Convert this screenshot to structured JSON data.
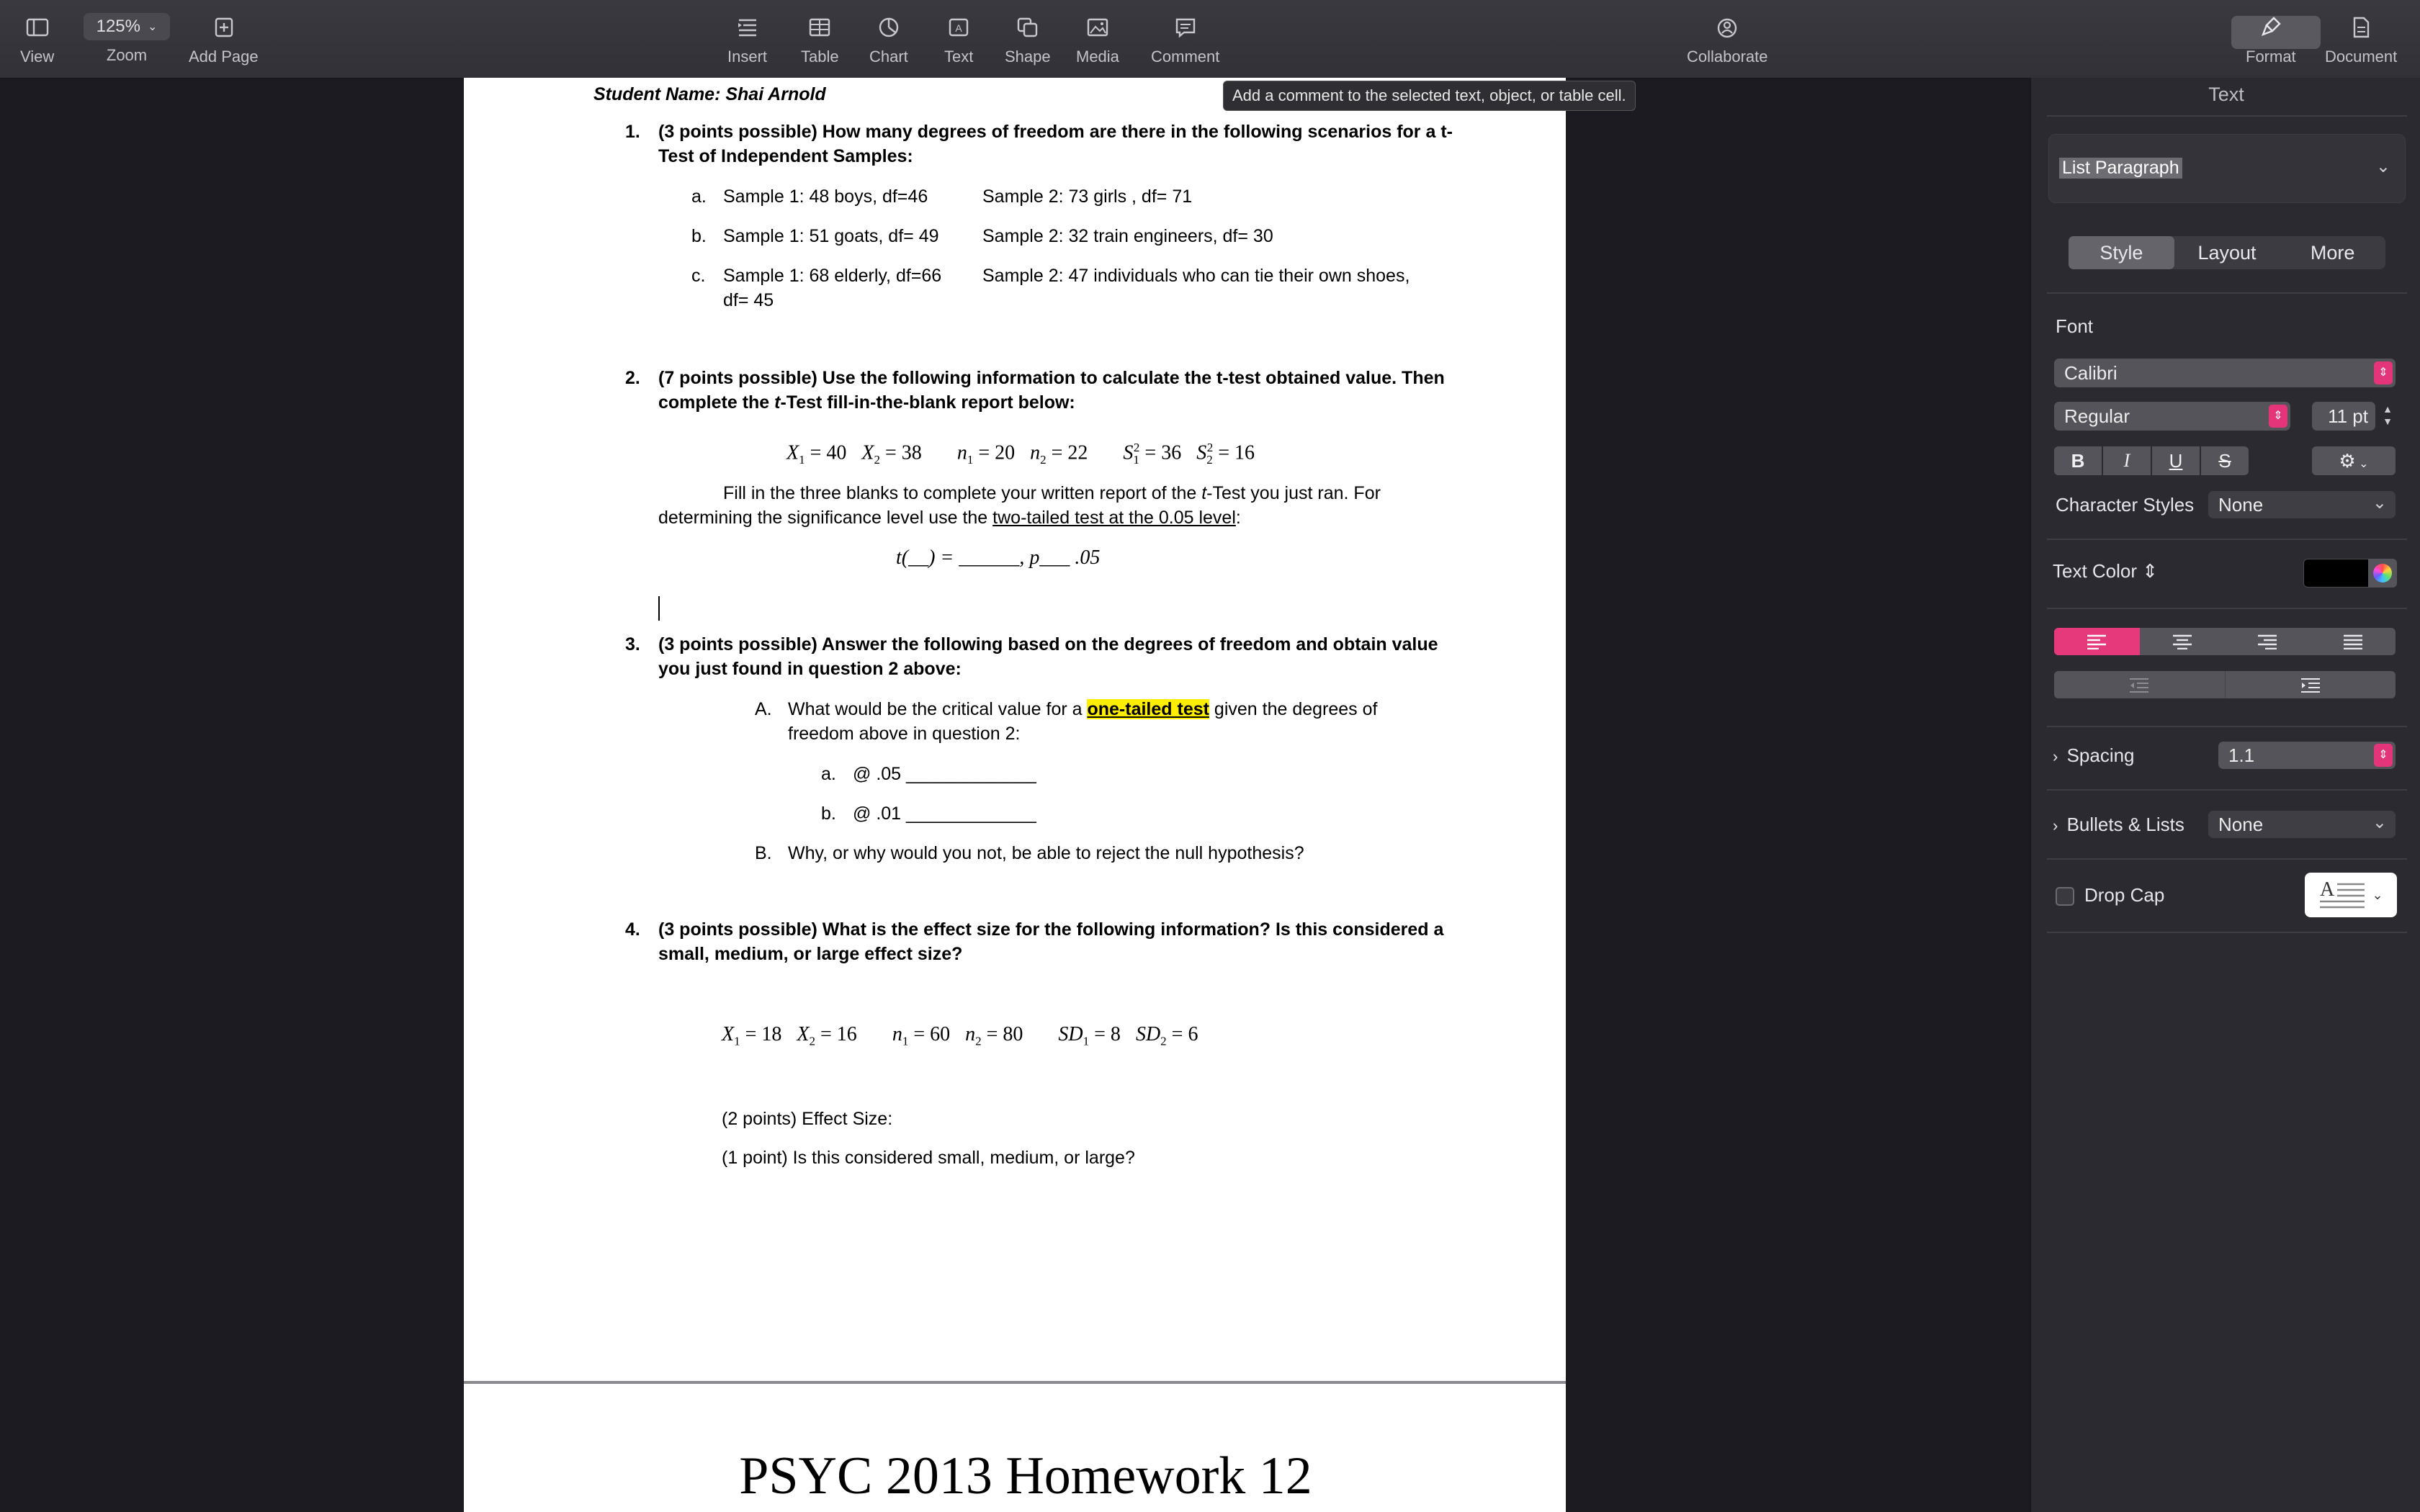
{
  "toolbar": {
    "view": "View",
    "zoom_value": "125%",
    "zoom": "Zoom",
    "add_page": "Add Page",
    "insert": "Insert",
    "table": "Table",
    "chart": "Chart",
    "text": "Text",
    "shape": "Shape",
    "media": "Media",
    "comment": "Comment",
    "collaborate": "Collaborate",
    "format": "Format",
    "document": "Document"
  },
  "tooltip": "Add a comment to the selected text, object, or table cell.",
  "doc": {
    "student": "Student Name: Shai Arnold",
    "q1_num": "1.",
    "q1_line1": "(3 points possible) How many degrees of freedom are there in the following scenarios for a t-",
    "q1_line2": "Test of Independent Samples:",
    "q1a_letter": "a.",
    "q1a_s1": "Sample 1: 48 boys, df=46",
    "q1a_s2": "Sample 2: 73 girls , df= 71",
    "q1b_letter": "b.",
    "q1b_s1": "Sample 1: 51 goats, df= 49",
    "q1b_s2": "Sample 2: 32 train engineers, df= 30",
    "q1c_letter": "c.",
    "q1c_s1": "Sample 1: 68 elderly, df=66",
    "q1c_s2": "Sample 2: 47 individuals who can tie their own shoes,",
    "q1c_s2b": "df= 45",
    "q2_num": "2.",
    "q2_line1": "(7 points possible) Use the following information to calculate the t-test obtained value. Then",
    "q2_line2a": "complete the ",
    "q2_line2b": "t",
    "q2_line2c": "-Test fill-in-the-blank report below:",
    "q2_x1": "X",
    "q2_x1v": " = 40",
    "q2_x2": "X",
    "q2_x2v": " = 38",
    "q2_n1": "n",
    "q2_n1v": " = 20",
    "q2_n2": "n",
    "q2_n2v": " = 22",
    "q2_s1": "S",
    "q2_s1v": " = 36",
    "q2_s2": "S",
    "q2_s2v": " = 16",
    "q2_fill1a": "Fill in the three blanks to complete your written report of the ",
    "q2_fill1b": "t",
    "q2_fill1c": "-Test you just ran. For",
    "q2_fill2a": "determining the significance level use the ",
    "q2_fill2b": "two-tailed test at the 0.05 level",
    "q2_fill2c": ":",
    "q2_formula": "t(__) = ______, p___ .05",
    "q3_num": "3.",
    "q3_line1": "(3 points possible) Answer the following based on the degrees of freedom and obtain value",
    "q3_line2": "you just found in question 2 above:",
    "q3A_letter": "A.",
    "q3A_1a": "What would be the critical value for a ",
    "q3A_1b": "one-tailed test",
    "q3A_1c": " given the degrees of",
    "q3A_2": "freedom above in question 2:",
    "q3a_letter": "a.",
    "q3a_text": "@ .05 _____________",
    "q3b_letter": "b.",
    "q3b_text": "@ .01 _____________",
    "q3B_letter": "B.",
    "q3B_text": "Why, or why would you not, be able to reject the null hypothesis?",
    "q4_num": "4.",
    "q4_line1": "(3 points possible) What is the effect size for the following information? Is this considered a",
    "q4_line2": "small, medium, or large effect size?",
    "q4_x1": "X",
    "q4_x1v": " = 18",
    "q4_x2": "X",
    "q4_x2v": " = 16",
    "q4_n1": "n",
    "q4_n1v": " = 60",
    "q4_n2": "n",
    "q4_n2v": " = 80",
    "q4_sd1": "SD",
    "q4_sd1v": " = 8",
    "q4_sd2": "SD",
    "q4_sd2v": " = 6",
    "q4_effect": "(2 points) Effect Size:",
    "q4_consider": "(1 point) Is this considered small, medium, or large?",
    "next_title": "PSYC 2013 Homework 12"
  },
  "sidebar": {
    "header": "Text",
    "paragraph_style": "List Paragraph",
    "tabs": [
      "Style",
      "Layout",
      "More"
    ],
    "font_label": "Font",
    "font_family": "Calibri",
    "font_typeface": "Regular",
    "font_size": "11 pt",
    "bold": "B",
    "italic": "I",
    "underline": "U",
    "strike": "S",
    "char_styles_label": "Character Styles",
    "char_styles_value": "None",
    "text_color_label": "Text Color",
    "spacing_label": "Spacing",
    "spacing_value": "1.1",
    "bullets_label": "Bullets & Lists",
    "bullets_value": "None",
    "dropcap_label": "Drop Cap",
    "accent_color": "#e5397c"
  }
}
